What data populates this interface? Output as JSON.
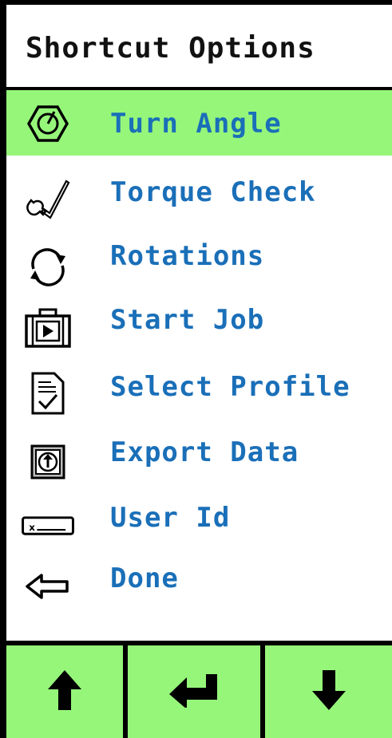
{
  "header": {
    "title": "Shortcut Options"
  },
  "colors": {
    "accent": "#96f67a",
    "label": "#1a6fb8",
    "border": "#000000"
  },
  "menu": {
    "selected_index": 0,
    "items": [
      {
        "label": "Turn Angle",
        "icon": "hex-nut-angle-icon"
      },
      {
        "label": "Torque Check",
        "icon": "wrench-check-icon"
      },
      {
        "label": "Rotations",
        "icon": "rotate-arrows-icon"
      },
      {
        "label": "Start Job",
        "icon": "briefcase-play-icon"
      },
      {
        "label": "Select Profile",
        "icon": "document-check-icon"
      },
      {
        "label": "Export Data",
        "icon": "export-data-icon"
      },
      {
        "label": "User Id",
        "icon": "id-field-icon"
      },
      {
        "label": "Done",
        "icon": "back-arrow-icon"
      }
    ]
  },
  "footer": {
    "buttons": [
      {
        "name": "up",
        "icon": "arrow-up-icon"
      },
      {
        "name": "enter",
        "icon": "enter-icon"
      },
      {
        "name": "down",
        "icon": "arrow-down-icon"
      }
    ]
  }
}
